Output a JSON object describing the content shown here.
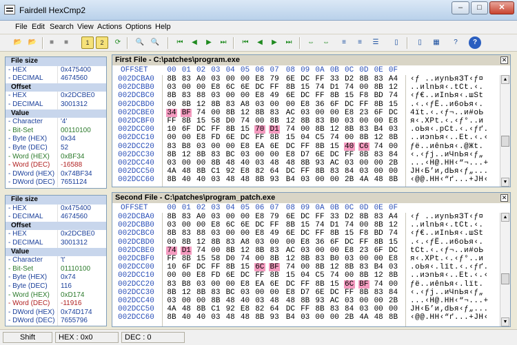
{
  "window": {
    "title": "Fairdell HexCmp2",
    "min_label": "–",
    "max_label": "□",
    "close_label": "✕"
  },
  "menu": [
    "File",
    "Edit",
    "Search",
    "View",
    "Actions",
    "Options",
    "Help"
  ],
  "toolbar": {
    "buttons": [
      {
        "name": "open-file-1",
        "glyph": "📂"
      },
      {
        "name": "open-file-2",
        "glyph": "📂"
      },
      {
        "name": "stop",
        "glyph": "■"
      },
      {
        "name": "pause",
        "glyph": "■"
      },
      {
        "name": "file-1-info",
        "glyph": "1"
      },
      {
        "name": "file-2-info",
        "glyph": "2"
      },
      {
        "name": "refresh",
        "glyph": "⟳"
      },
      {
        "name": "search",
        "glyph": "🔍"
      },
      {
        "name": "search-next",
        "glyph": "🔍"
      },
      {
        "name": "first-difference",
        "glyph": "⏮"
      },
      {
        "name": "previous-difference",
        "glyph": "◀"
      },
      {
        "name": "next-difference",
        "glyph": "▶"
      },
      {
        "name": "last-difference",
        "glyph": "⏭"
      },
      {
        "name": "sync-first",
        "glyph": "⏮"
      },
      {
        "name": "sync-previous",
        "glyph": "◀"
      },
      {
        "name": "sync-next",
        "glyph": "▶"
      },
      {
        "name": "sync-last",
        "glyph": "⏭"
      },
      {
        "name": "compare",
        "glyph": "⇔"
      },
      {
        "name": "compare-2",
        "glyph": "⇔"
      },
      {
        "name": "align-left",
        "glyph": "≡"
      },
      {
        "name": "align-right",
        "glyph": "≡"
      },
      {
        "name": "list-view",
        "glyph": "☰"
      },
      {
        "name": "page-1",
        "glyph": "▯"
      },
      {
        "name": "page-2",
        "glyph": "▯"
      },
      {
        "name": "grid",
        "glyph": "▦"
      },
      {
        "name": "help",
        "glyph": "?"
      }
    ]
  },
  "panels": [
    {
      "rows": [
        {
          "type": "section",
          "label": "File size"
        },
        {
          "label": "- HEX",
          "value": "0x475400",
          "color": "blue"
        },
        {
          "label": "- DECIMAL",
          "value": "4674560",
          "color": "blue"
        },
        {
          "type": "section",
          "label": "Offset"
        },
        {
          "label": "- HEX",
          "value": "0x2DCBE0",
          "color": "blue"
        },
        {
          "label": "- DECIMAL",
          "value": "3001312",
          "color": "blue"
        },
        {
          "type": "section",
          "label": "Value"
        },
        {
          "label": "- Character",
          "value": "'4'",
          "color": "blue"
        },
        {
          "label": "- Bit-Set",
          "value": "00110100",
          "color": "green"
        },
        {
          "label": "- Byte (HEX)",
          "value": "0x34",
          "color": "blue"
        },
        {
          "label": "- Byte (DEC)",
          "value": "52",
          "color": "blue"
        },
        {
          "label": "- Word (HEX)",
          "value": "0xBF34",
          "color": "green"
        },
        {
          "label": "- Word (DEC)",
          "value": "-16588",
          "color": "red"
        },
        {
          "label": "- DWord (HEX)",
          "value": "0x74BF34",
          "color": "blue"
        },
        {
          "label": "- DWord (DEC)",
          "value": "7651124",
          "color": "blue"
        }
      ]
    },
    {
      "rows": [
        {
          "type": "section",
          "label": "File size"
        },
        {
          "label": "- HEX",
          "value": "0x475400",
          "color": "blue"
        },
        {
          "label": "- DECIMAL",
          "value": "4674560",
          "color": "blue"
        },
        {
          "type": "section",
          "label": "Offset"
        },
        {
          "label": "- HEX",
          "value": "0x2DCBE0",
          "color": "blue"
        },
        {
          "label": "- DECIMAL",
          "value": "3001312",
          "color": "blue"
        },
        {
          "type": "section",
          "label": "Value"
        },
        {
          "label": "- Character",
          "value": "'t'",
          "color": "blue"
        },
        {
          "label": "- Bit-Set",
          "value": "01110100",
          "color": "green"
        },
        {
          "label": "- Byte (HEX)",
          "value": "0x74",
          "color": "blue"
        },
        {
          "label": "- Byte (DEC)",
          "value": "116",
          "color": "blue"
        },
        {
          "label": "- Word (HEX)",
          "value": "0xD174",
          "color": "green"
        },
        {
          "label": "- Word (DEC)",
          "value": "-11916",
          "color": "red"
        },
        {
          "label": "- DWord (HEX)",
          "value": "0x74D174",
          "color": "blue"
        },
        {
          "label": "- DWord (DEC)",
          "value": "7655796",
          "color": "blue"
        }
      ]
    }
  ],
  "files": [
    {
      "title": "First File - C:\\patches\\program.exe",
      "offset_header": "OFFSET",
      "col_headers": [
        "00",
        "01",
        "02",
        "03",
        "04",
        "05",
        "06",
        "07",
        "08",
        "09",
        "0A",
        "0B",
        "0C",
        "0D",
        "0E",
        "0F"
      ],
      "rows": [
        {
          "offset": "002DCBA0",
          "bytes": [
            "8B",
            "83",
            "A0",
            "03",
            "00",
            "00",
            "E8",
            "79",
            "6E",
            "DC",
            "FF",
            "33",
            "D2",
            "8B",
            "83",
            "A4"
          ],
          "hl": [],
          "ascii": "‹ƒ ..иynЬяЗТ‹ƒ¤"
        },
        {
          "offset": "002DCBB0",
          "bytes": [
            "03",
            "00",
            "00",
            "E8",
            "6C",
            "6E",
            "DC",
            "FF",
            "8B",
            "15",
            "74",
            "D1",
            "74",
            "00",
            "8B",
            "12"
          ],
          "hl": [],
          "ascii": "..иlnЬя‹.tСt.‹."
        },
        {
          "offset": "002DCBC0",
          "bytes": [
            "8B",
            "83",
            "88",
            "03",
            "00",
            "00",
            "E8",
            "49",
            "6E",
            "DC",
            "FF",
            "8B",
            "15",
            "F8",
            "BD",
            "74"
          ],
          "hl": [],
          "ascii": "‹ƒ€..иInЬя‹.шЅt"
        },
        {
          "offset": "002DCBD0",
          "bytes": [
            "00",
            "8B",
            "12",
            "8B",
            "83",
            "A8",
            "03",
            "00",
            "00",
            "E8",
            "36",
            "6F",
            "DC",
            "FF",
            "8B",
            "15"
          ],
          "hl": [],
          "ascii": ".‹.‹ƒЁ..и6oЬя‹."
        },
        {
          "offset": "002DCBE0",
          "bytes": [
            "34",
            "BF",
            "74",
            "00",
            "8B",
            "12",
            "8B",
            "83",
            "AC",
            "03",
            "00",
            "00",
            "E8",
            "23",
            "6F",
            "DC"
          ],
          "hl": [
            0,
            1
          ],
          "ascii": "4їt.‹.‹ƒ¬..и#oЬ"
        },
        {
          "offset": "002DCBF0",
          "bytes": [
            "FF",
            "8B",
            "15",
            "58",
            "D0",
            "74",
            "00",
            "8B",
            "12",
            "8B",
            "83",
            "B0",
            "03",
            "00",
            "00",
            "E8"
          ],
          "hl": [],
          "ascii": "я‹.XРt.‹.‹ƒ°..и"
        },
        {
          "offset": "002DCC00",
          "bytes": [
            "10",
            "6F",
            "DC",
            "FF",
            "8B",
            "15",
            "70",
            "D1",
            "74",
            "00",
            "8B",
            "12",
            "8B",
            "83",
            "B4",
            "03"
          ],
          "hl": [
            6,
            7
          ],
          "ascii": ".oЬя‹.pСt.‹.‹ƒґ."
        },
        {
          "offset": "002DCC10",
          "bytes": [
            "00",
            "00",
            "E8",
            "FD",
            "6E",
            "DC",
            "FF",
            "8B",
            "15",
            "04",
            "C5",
            "74",
            "00",
            "8B",
            "12",
            "8B"
          ],
          "hl": [],
          "ascii": "..иэnЬя‹..Еt.‹.‹"
        },
        {
          "offset": "002DCC20",
          "bytes": [
            "83",
            "B8",
            "03",
            "00",
            "00",
            "E8",
            "EA",
            "6E",
            "DC",
            "FF",
            "8B",
            "15",
            "40",
            "C6",
            "74",
            "00"
          ],
          "hl": [
            12,
            13
          ],
          "ascii": "ƒё..иênЬя‹.@Жt."
        },
        {
          "offset": "002DCC30",
          "bytes": [
            "8B",
            "12",
            "8B",
            "83",
            "BC",
            "03",
            "00",
            "00",
            "E8",
            "D7",
            "6E",
            "DC",
            "FF",
            "8B",
            "83",
            "84"
          ],
          "hl": [],
          "ascii": "‹.‹ƒј..иЧnЬя‹ƒ„"
        },
        {
          "offset": "002DCC40",
          "bytes": [
            "03",
            "00",
            "00",
            "8B",
            "48",
            "40",
            "03",
            "48",
            "48",
            "8B",
            "93",
            "AC",
            "03",
            "00",
            "00",
            "2B"
          ],
          "hl": [],
          "ascii": "...‹H@.HH‹“¬...+"
        },
        {
          "offset": "002DCC50",
          "bytes": [
            "4A",
            "48",
            "8B",
            "C1",
            "92",
            "E8",
            "82",
            "64",
            "DC",
            "FF",
            "8B",
            "83",
            "84",
            "03",
            "00",
            "00"
          ],
          "hl": [],
          "ascii": "JH‹Б’и‚dЬя‹ƒ„..."
        },
        {
          "offset": "002DCC60",
          "bytes": [
            "8B",
            "40",
            "40",
            "03",
            "48",
            "48",
            "8B",
            "93",
            "B4",
            "03",
            "00",
            "00",
            "2B",
            "4A",
            "48",
            "8B"
          ],
          "hl": [],
          "ascii": "‹@@.HH‹“ґ...+JH‹"
        }
      ]
    },
    {
      "title": "Second File - C:\\patches\\program_patch.exe",
      "offset_header": "OFFSET",
      "col_headers": [
        "00",
        "01",
        "02",
        "03",
        "04",
        "05",
        "06",
        "07",
        "08",
        "09",
        "0A",
        "0B",
        "0C",
        "0D",
        "0E",
        "0F"
      ],
      "rows": [
        {
          "offset": "002DCBA0",
          "bytes": [
            "8B",
            "83",
            "A0",
            "03",
            "00",
            "00",
            "E8",
            "79",
            "6E",
            "DC",
            "FF",
            "33",
            "D2",
            "8B",
            "83",
            "A4"
          ],
          "hl": [],
          "ascii": "‹ƒ ..иynЬяЗТ‹ƒ¤"
        },
        {
          "offset": "002DCBB0",
          "bytes": [
            "03",
            "00",
            "00",
            "E8",
            "6C",
            "6E",
            "DC",
            "FF",
            "8B",
            "15",
            "74",
            "D1",
            "74",
            "00",
            "8B",
            "12"
          ],
          "hl": [],
          "ascii": "..иlnЬя‹.tСt.‹."
        },
        {
          "offset": "002DCBC0",
          "bytes": [
            "8B",
            "83",
            "88",
            "03",
            "00",
            "00",
            "E8",
            "49",
            "6E",
            "DC",
            "FF",
            "8B",
            "15",
            "F8",
            "BD",
            "74"
          ],
          "hl": [],
          "ascii": "‹ƒ€..иInЬя‹.шЅt"
        },
        {
          "offset": "002DCBD0",
          "bytes": [
            "00",
            "8B",
            "12",
            "8B",
            "83",
            "A8",
            "03",
            "00",
            "00",
            "E8",
            "36",
            "6F",
            "DC",
            "FF",
            "8B",
            "15"
          ],
          "hl": [],
          "ascii": ".‹.‹ƒЁ..и6oЬя‹."
        },
        {
          "offset": "002DCBE0",
          "bytes": [
            "74",
            "D1",
            "74",
            "00",
            "8B",
            "12",
            "8B",
            "83",
            "AC",
            "03",
            "00",
            "00",
            "E8",
            "23",
            "6F",
            "DC"
          ],
          "hl": [
            0,
            1
          ],
          "ascii": "tСt.‹.‹ƒ¬..и#oЬ"
        },
        {
          "offset": "002DCBF0",
          "bytes": [
            "FF",
            "8B",
            "15",
            "58",
            "D0",
            "74",
            "00",
            "8B",
            "12",
            "8B",
            "83",
            "B0",
            "03",
            "00",
            "00",
            "E8"
          ],
          "hl": [],
          "ascii": "я‹.XРt.‹.‹ƒ°..и"
        },
        {
          "offset": "002DCC00",
          "bytes": [
            "10",
            "6F",
            "DC",
            "FF",
            "8B",
            "15",
            "6C",
            "BF",
            "74",
            "00",
            "8B",
            "12",
            "8B",
            "83",
            "B4",
            "03"
          ],
          "hl": [
            6,
            7
          ],
          "ascii": ".oЬя‹.lїt.‹.‹ƒґ."
        },
        {
          "offset": "002DCC10",
          "bytes": [
            "00",
            "00",
            "E8",
            "FD",
            "6E",
            "DC",
            "FF",
            "8B",
            "15",
            "04",
            "C5",
            "74",
            "00",
            "8B",
            "12",
            "8B"
          ],
          "hl": [],
          "ascii": "..иэnЬя‹..Еt.‹.‹"
        },
        {
          "offset": "002DCC20",
          "bytes": [
            "83",
            "B8",
            "03",
            "00",
            "00",
            "E8",
            "EA",
            "6E",
            "DC",
            "FF",
            "8B",
            "15",
            "6C",
            "BF",
            "74",
            "00"
          ],
          "hl": [
            12,
            13
          ],
          "ascii": "ƒё..иênЬя‹.lїt."
        },
        {
          "offset": "002DCC30",
          "bytes": [
            "8B",
            "12",
            "8B",
            "83",
            "BC",
            "03",
            "00",
            "00",
            "E8",
            "D7",
            "6E",
            "DC",
            "FF",
            "8B",
            "83",
            "84"
          ],
          "hl": [],
          "ascii": "‹.‹ƒј..иЧnЬя‹ƒ„"
        },
        {
          "offset": "002DCC40",
          "bytes": [
            "03",
            "00",
            "00",
            "8B",
            "48",
            "40",
            "03",
            "48",
            "48",
            "8B",
            "93",
            "AC",
            "03",
            "00",
            "00",
            "2B"
          ],
          "hl": [],
          "ascii": "...‹H@.HH‹“¬...+"
        },
        {
          "offset": "002DCC50",
          "bytes": [
            "4A",
            "48",
            "8B",
            "C1",
            "92",
            "E8",
            "82",
            "64",
            "DC",
            "FF",
            "8B",
            "83",
            "84",
            "03",
            "00",
            "00"
          ],
          "hl": [],
          "ascii": "JH‹Б’и‚dЬя‹ƒ„..."
        },
        {
          "offset": "002DCC60",
          "bytes": [
            "8B",
            "40",
            "40",
            "03",
            "48",
            "48",
            "8B",
            "93",
            "B4",
            "03",
            "00",
            "00",
            "2B",
            "4A",
            "48",
            "8B"
          ],
          "hl": [],
          "ascii": "‹@@.HH‹“ґ...+JH‹"
        }
      ]
    }
  ],
  "status": {
    "mode": "Shift",
    "hex": "HEX : 0x0",
    "dec": "DEC : 0"
  },
  "colors": {
    "highlight": "#f59bc0",
    "offset_text": "#2a4fb8",
    "section_bg": "#c8d6ec"
  }
}
